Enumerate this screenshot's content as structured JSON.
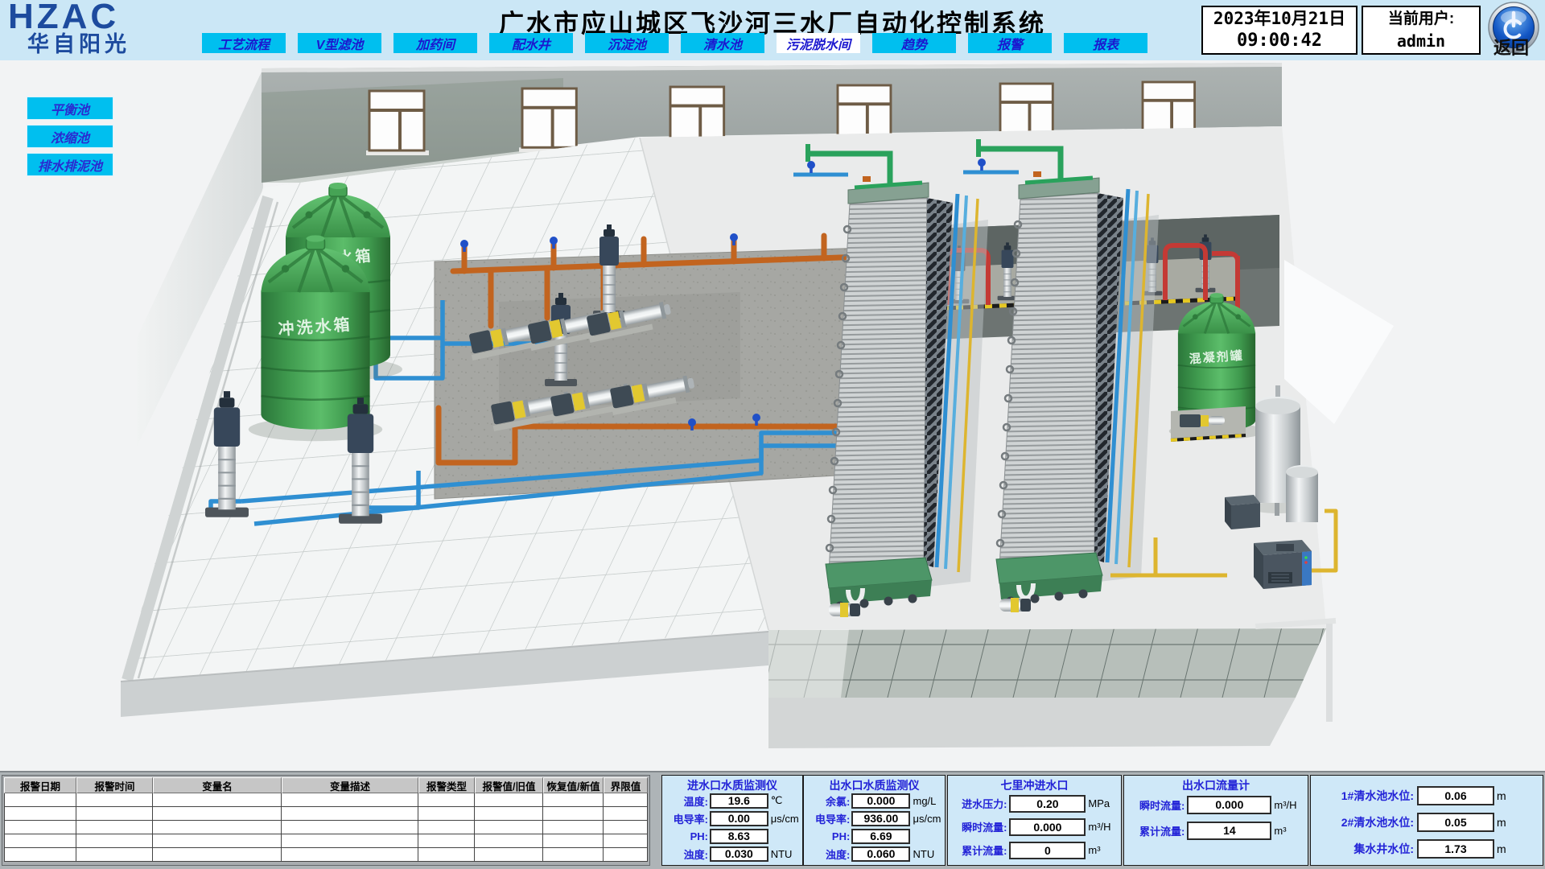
{
  "header": {
    "logo_main": "HZAC",
    "logo_sub": "华自阳光",
    "title": "广水市应山城区飞沙河三水厂自动化控制系统",
    "date": "2023年10月21日",
    "time": "09:00:42",
    "user_label": "当前用户:",
    "user_value": "admin",
    "back_label": "返回"
  },
  "nav": {
    "items": [
      "工艺流程",
      "V型滤池",
      "加药间",
      "配水井",
      "沉淀池",
      "清水池",
      "污泥脱水间",
      "趋势",
      "报警",
      "报表"
    ],
    "active": "污泥脱水间"
  },
  "side_buttons": [
    "平衡池",
    "浓缩池",
    "排水排泥池"
  ],
  "alarm_table": {
    "headers": [
      "报警日期",
      "报警时间",
      "变量名",
      "变量描述",
      "报警类型",
      "报警值/旧值",
      "恢复值/新值",
      "界限值"
    ],
    "rows": [
      [],
      [],
      [],
      [],
      []
    ]
  },
  "panels": [
    {
      "title": "进水口水质监测仪",
      "rows": [
        {
          "label": "温度:",
          "value": "19.6",
          "unit": "℃"
        },
        {
          "label": "电导率:",
          "value": "0.00",
          "unit": "μs/cm"
        },
        {
          "label": "PH:",
          "value": "8.63",
          "unit": ""
        },
        {
          "label": "浊度:",
          "value": "0.030",
          "unit": "NTU"
        }
      ]
    },
    {
      "title": "出水口水质监测仪",
      "rows": [
        {
          "label": "余氯:",
          "value": "0.000",
          "unit": "mg/L"
        },
        {
          "label": "电导率:",
          "value": "936.00",
          "unit": "μs/cm"
        },
        {
          "label": "PH:",
          "value": "6.69",
          "unit": ""
        },
        {
          "label": "浊度:",
          "value": "0.060",
          "unit": "NTU"
        }
      ]
    },
    {
      "title": "七里冲进水口",
      "rows": [
        {
          "label": "进水压力:",
          "value": "0.20",
          "unit": "MPa"
        },
        {
          "label": "瞬时流量:",
          "value": "0.000",
          "unit": "m³/H"
        },
        {
          "label": "累计流量:",
          "value": "0",
          "unit": "m³"
        }
      ]
    },
    {
      "title": "出水口流量计",
      "rows": [
        {
          "label": "瞬时流量:",
          "value": "0.000",
          "unit": "m³/H"
        },
        {
          "label": "累计流量:",
          "value": "14",
          "unit": "m³"
        }
      ]
    },
    {
      "title": "",
      "rows": [
        {
          "label": "1#清水池水位:",
          "value": "0.06",
          "unit": "m"
        },
        {
          "label": "2#清水池水位:",
          "value": "0.05",
          "unit": "m"
        },
        {
          "label": "集水井水位:",
          "value": "1.73",
          "unit": "m"
        }
      ]
    }
  ],
  "scene": {
    "tank_press_label": "压榨水箱",
    "tank_rinse_label": "冲洗水箱",
    "tank_coag_label": "混凝剂罐"
  },
  "colors": {
    "header_bg": "#cbe7f6",
    "nav_bg": "#00bfef",
    "nav_active_bg": "#ffffff",
    "nav_text": "#1b18cf",
    "panel_bg": "#cfe8f8",
    "label_blue": "#2323d7",
    "logo_navy": "#1d4b9e",
    "tank_green": "#3f9a4e",
    "pipe_orange": "#c2641f",
    "pipe_blue": "#2f8fd2",
    "pipe_green": "#2aa25c",
    "pipe_red": "#c43a35",
    "pipe_yellow": "#ddb52f"
  }
}
